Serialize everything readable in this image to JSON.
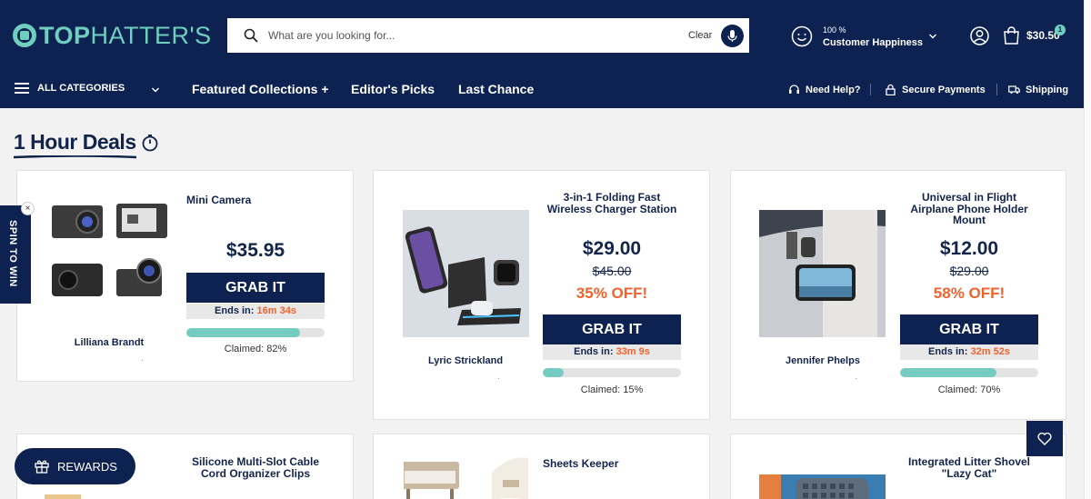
{
  "header": {
    "logo": {
      "bold": "TOP",
      "light": "HATTER'S"
    },
    "search": {
      "placeholder": "What are you looking for...",
      "clear_label": "Clear"
    },
    "happiness": {
      "top": "100 %",
      "bottom": "Customer Happiness"
    },
    "cart": {
      "total": "$30.50",
      "count": "1"
    }
  },
  "nav": {
    "categories_label": "ALL CATEGORIES",
    "links": [
      "Featured Collections +",
      "Editor's Picks",
      "Last Chance"
    ],
    "utilities": [
      "Need Help?",
      "Secure Payments",
      "Shipping"
    ]
  },
  "spin": {
    "label": "SPIN TO WIN",
    "close": "×"
  },
  "section": {
    "title": "1 Hour Deals"
  },
  "cards": [
    {
      "name": "Mini Camera",
      "price": "$35.95",
      "old_price": "",
      "off": "",
      "grab": "GRAB IT",
      "ends_label": "Ends in:",
      "ends_time": "16m 34s",
      "claimed_pct": 82,
      "claimed_text": "Claimed: 82%",
      "buyer": "Lilliana Brandt"
    },
    {
      "name": "3-in-1 Folding Fast Wireless Charger Station",
      "price": "$29.00",
      "old_price": "$45.00",
      "off": "35% OFF!",
      "grab": "GRAB IT",
      "ends_label": "Ends in:",
      "ends_time": "33m 9s",
      "claimed_pct": 15,
      "claimed_text": "Claimed: 15%",
      "buyer": "Lyric Strickland"
    },
    {
      "name": "Universal in Flight Airplane Phone Holder Mount",
      "price": "$12.00",
      "old_price": "$29.00",
      "off": "58% OFF!",
      "grab": "GRAB IT",
      "ends_label": "Ends in:",
      "ends_time": "32m 52s",
      "claimed_pct": 70,
      "claimed_text": "Claimed: 70%",
      "buyer": "Jennifer Phelps"
    },
    {
      "name": "Silicone Multi-Slot Cable Cord Organizer Clips"
    },
    {
      "name": "Sheets Keeper"
    },
    {
      "name": "Integrated Litter Shovel \"Lazy Cat\""
    }
  ],
  "rewards": {
    "label": "REWARDS"
  },
  "colors": {
    "navy": "#0d2250",
    "teal": "#6fcfbf",
    "orange": "#f2622e"
  }
}
